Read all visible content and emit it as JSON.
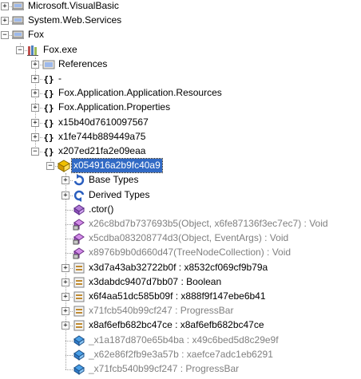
{
  "tree": {
    "rows": [
      {
        "label": "Microsoft.VisualBasic",
        "icon": "assembly-icon",
        "toggle": "+"
      },
      {
        "label": "System.Web.Services",
        "icon": "assembly-icon",
        "toggle": "+"
      },
      {
        "label": "Fox",
        "icon": "assembly-icon",
        "toggle": "-"
      },
      {
        "label": "Fox.exe",
        "icon": "module-icon",
        "toggle": "-"
      },
      {
        "label": "References",
        "icon": "references-folder-icon",
        "toggle": "+"
      },
      {
        "label": "-",
        "icon": "namespace-icon",
        "toggle": "+"
      },
      {
        "label": "Fox.Application.Application.Resources",
        "icon": "namespace-icon",
        "toggle": "+"
      },
      {
        "label": "Fox.Application.Properties",
        "icon": "namespace-icon",
        "toggle": "+"
      },
      {
        "label": "x15b40d7610097567",
        "icon": "namespace-icon",
        "toggle": "+"
      },
      {
        "label": "x1fe744b889449a75",
        "icon": "namespace-icon",
        "toggle": "+"
      },
      {
        "label": "x207ed21fa2e09eaa",
        "icon": "namespace-icon",
        "toggle": "-"
      },
      {
        "label": "x054916a2b9fc40a9",
        "icon": "class-icon",
        "toggle": "-",
        "selected": true
      },
      {
        "label": "Base Types",
        "icon": "base-types-icon",
        "toggle": "+"
      },
      {
        "label": "Derived Types",
        "icon": "derived-types-icon",
        "toggle": "+"
      },
      {
        "label": ".ctor()",
        "icon": "constructor-method-icon",
        "toggle": ""
      },
      {
        "label": "x26c8bd7b737693b5(Object, x6fe87136f3ec7ec7) : Void",
        "icon": "private-method-icon",
        "toggle": "",
        "grey": true
      },
      {
        "label": "x5cdba083208774d3(Object, EventArgs) : Void",
        "icon": "private-method-icon",
        "toggle": "",
        "grey": true
      },
      {
        "label": "x8976b9b0d660d47(TreeNodeCollection) : Void",
        "icon": "private-method-icon",
        "toggle": "",
        "grey": true
      },
      {
        "label": "x3d7a43ab32722b0f : x8532cf069cf9b79a",
        "icon": "property-icon",
        "toggle": "+"
      },
      {
        "label": "x3dabdc9407d7bb07 : Boolean",
        "icon": "property-icon",
        "toggle": "+"
      },
      {
        "label": "x6f4aa51dc585b09f : x888f9f147ebe6b41",
        "icon": "property-icon",
        "toggle": "+"
      },
      {
        "label": "x71fcb540b99cf247 : ProgressBar",
        "icon": "property-icon",
        "toggle": "+",
        "grey": true
      },
      {
        "label": "x8af6efb682bc47ce : x8af6efb682bc47ce",
        "icon": "property-icon",
        "toggle": "+"
      },
      {
        "label": "_x1a187d870e65b4ba : x49c6bed5d8c29e9f",
        "icon": "field-icon",
        "toggle": "",
        "grey": true
      },
      {
        "label": "_x62e86f2fb9e3a57b : xaefce7adc1eb6291",
        "icon": "field-icon",
        "toggle": "",
        "grey": true
      },
      {
        "label": "_x71fcb540b99cf247 : ProgressBar",
        "icon": "field-icon",
        "toggle": "",
        "grey": true
      }
    ]
  }
}
